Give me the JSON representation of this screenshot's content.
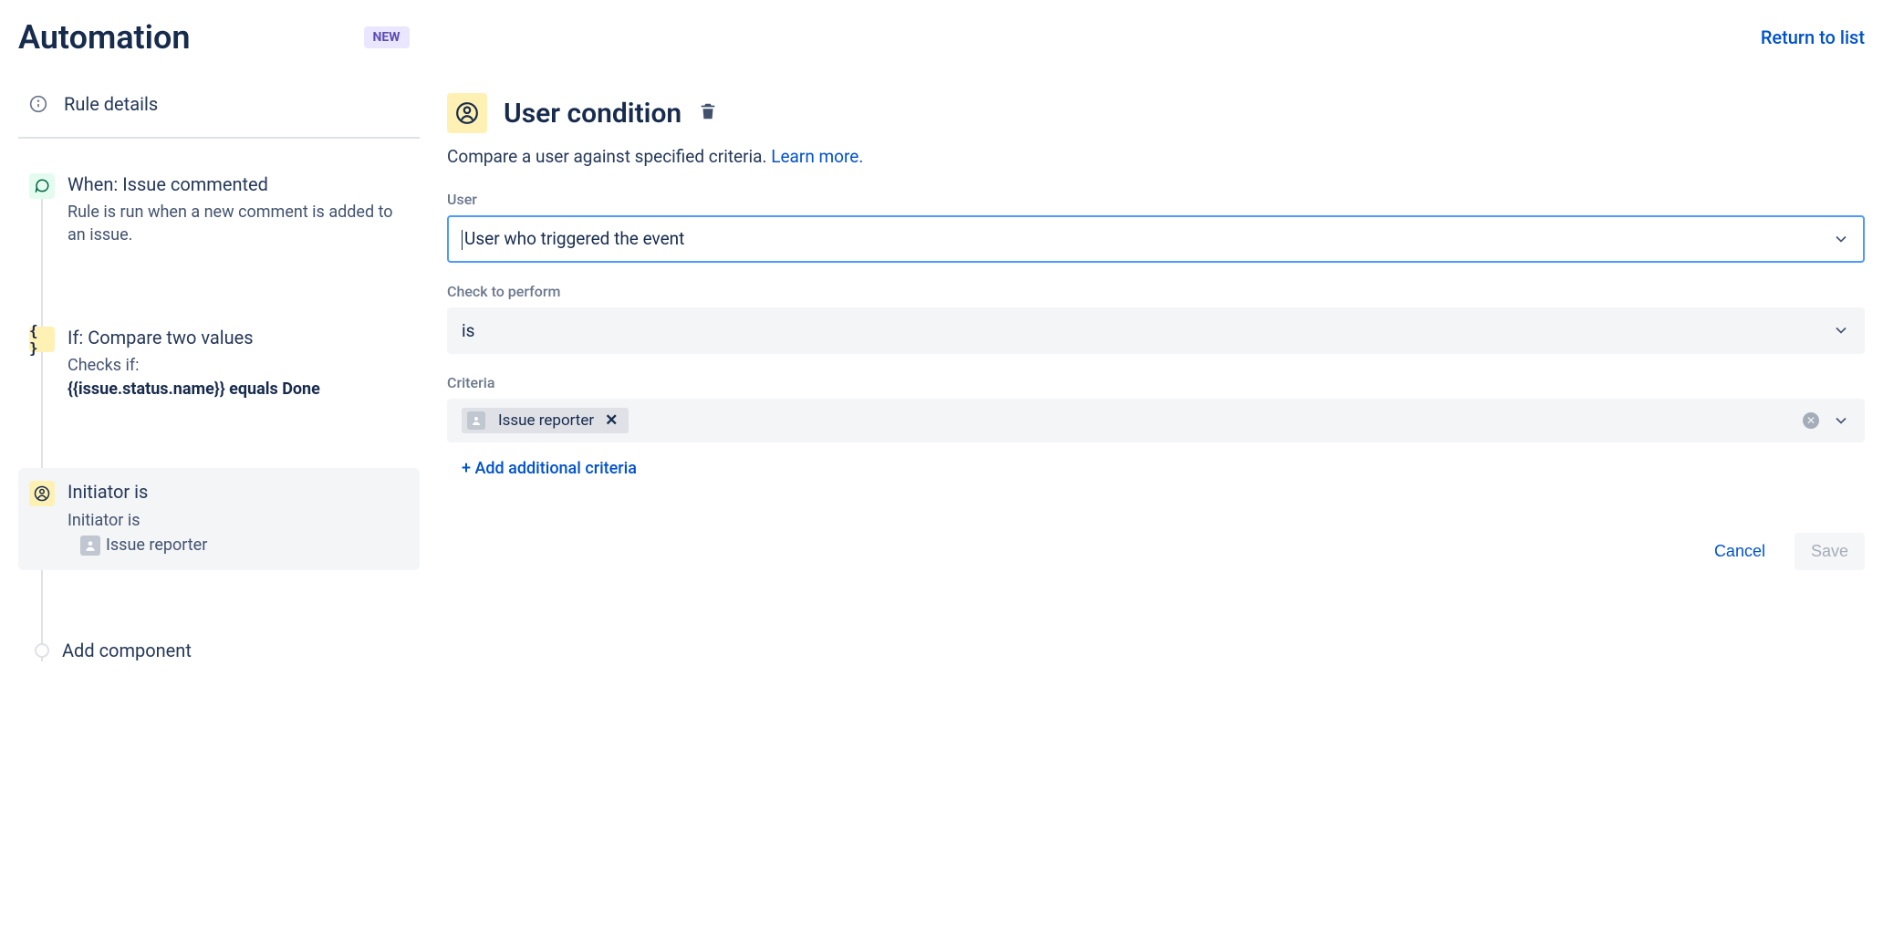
{
  "header": {
    "title": "Automation",
    "badge": "NEW",
    "return_link": "Return to list"
  },
  "sidebar": {
    "rule_details": "Rule details",
    "steps": [
      {
        "icon": "comment",
        "icon_color": "green",
        "title": "When: Issue commented",
        "desc_plain": "Rule is run when a new comment is added to an issue."
      },
      {
        "icon": "braces",
        "icon_color": "yellow",
        "title": "If: Compare two values",
        "desc_prefix": "Checks if:",
        "desc_strong": "{{issue.status.name}} equals Done"
      },
      {
        "icon": "user",
        "icon_color": "yellow",
        "title": "Initiator is",
        "sub_line1": "Initiator is",
        "sub_line2": "Issue reporter",
        "selected": true
      }
    ],
    "add_component": "Add component"
  },
  "main": {
    "title": "User condition",
    "desc_text": "Compare a user against specified criteria. ",
    "learn_more": "Learn more.",
    "fields": {
      "user_label": "User",
      "user_value": "User who triggered the event",
      "check_label": "Check to perform",
      "check_value": "is",
      "criteria_label": "Criteria",
      "criteria_chip": "Issue reporter",
      "add_criteria": "+ Add additional criteria"
    },
    "actions": {
      "cancel": "Cancel",
      "save": "Save"
    }
  }
}
